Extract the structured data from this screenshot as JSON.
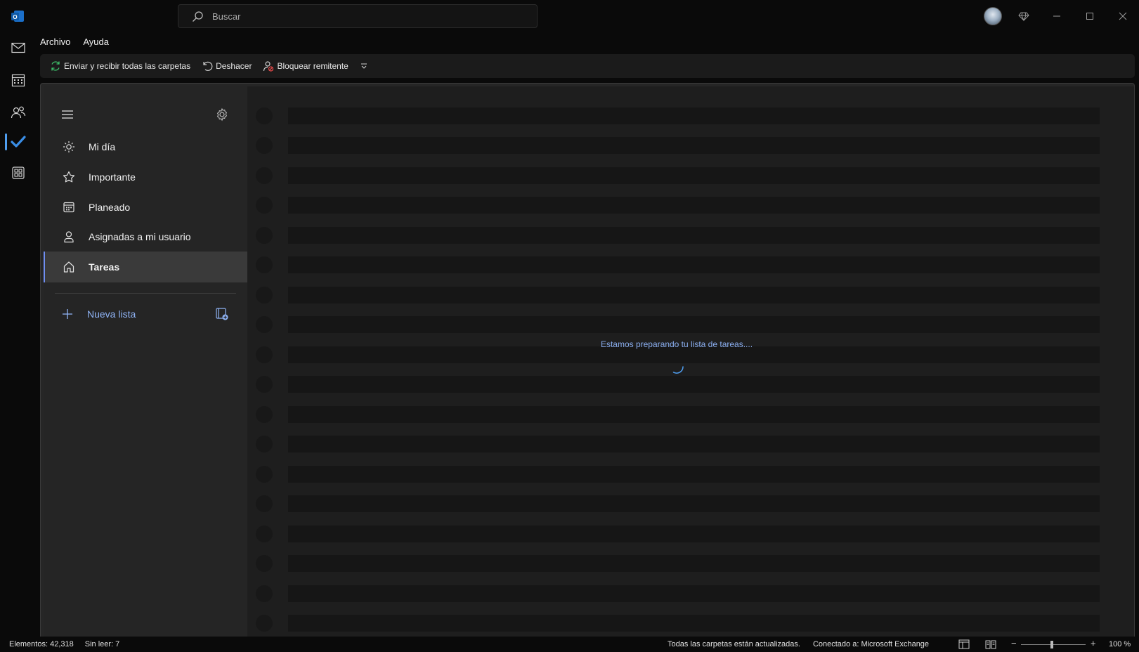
{
  "search": {
    "placeholder": "Buscar"
  },
  "menu": {
    "items": [
      "Archivo",
      "Ayuda"
    ]
  },
  "ribbon": {
    "send_receive": "Enviar y recibir todas las carpetas",
    "undo": "Deshacer",
    "block_sender": "Bloquear remitente"
  },
  "todo_nav": {
    "items": [
      {
        "label": "Mi día",
        "icon": "sun-icon"
      },
      {
        "label": "Importante",
        "icon": "star-icon"
      },
      {
        "label": "Planeado",
        "icon": "calendar-icon"
      },
      {
        "label": "Asignadas a mi usuario",
        "icon": "person-icon"
      },
      {
        "label": "Tareas",
        "icon": "home-icon",
        "active": true
      }
    ],
    "new_list": "Nueva lista"
  },
  "main": {
    "loading_text": "Estamos preparando tu lista de tareas...."
  },
  "status": {
    "items": "Elementos: 42,318",
    "unread": "Sin leer: 7",
    "folders": "Todas las carpetas están actualizadas.",
    "connection": "Conectado a: Microsoft Exchange",
    "zoom": "100 %"
  },
  "colors": {
    "accent": "#4f9ef0",
    "link": "#8fb3f5",
    "background": "#0a0a0a",
    "panel": "#252525"
  }
}
